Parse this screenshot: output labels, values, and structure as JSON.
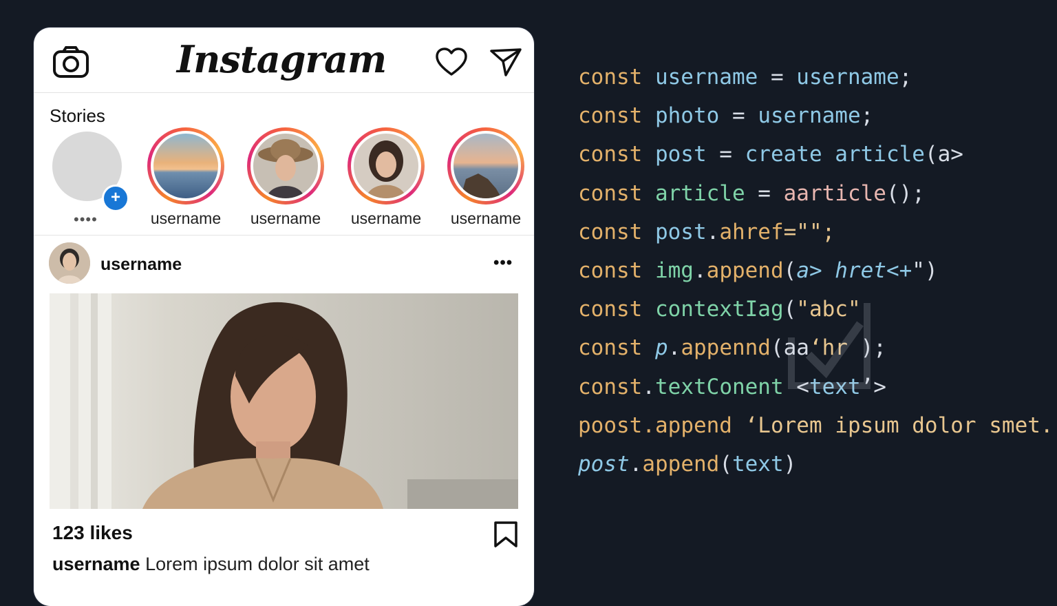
{
  "app": {
    "logo_text": "Instagram",
    "icons": [
      "camera-icon",
      "heart-icon",
      "send-icon"
    ]
  },
  "stories": {
    "title": "Stories",
    "own_dots": "••••",
    "items": [
      {
        "label": "username",
        "photo": "sunset-sea"
      },
      {
        "label": "username",
        "photo": "woman-hat"
      },
      {
        "label": "username",
        "photo": "woman-portrait"
      },
      {
        "label": "username",
        "photo": "coast-rocks"
      }
    ]
  },
  "post": {
    "username": "username",
    "more_label": "•••",
    "likes": "123 likes",
    "caption_user": "username",
    "caption_text": "Lorem ipsum dolor sit amet"
  },
  "code": {
    "lines": [
      [
        {
          "t": "const ",
          "c": "kw"
        },
        {
          "t": "username",
          "c": "id"
        },
        {
          "t": " = ",
          "c": ""
        },
        {
          "t": "username",
          "c": "id"
        },
        {
          "t": ";",
          "c": ""
        }
      ],
      [
        {
          "t": "const ",
          "c": "kw"
        },
        {
          "t": "photo",
          "c": "id"
        },
        {
          "t": " = ",
          "c": ""
        },
        {
          "t": "username",
          "c": "id"
        },
        {
          "t": ";",
          "c": ""
        }
      ],
      [
        {
          "t": "const ",
          "c": "kw"
        },
        {
          "t": "post",
          "c": "id"
        },
        {
          "t": " = ",
          "c": ""
        },
        {
          "t": "create article",
          "c": "id"
        },
        {
          "t": "(a>",
          "c": ""
        }
      ],
      [
        {
          "t": "const ",
          "c": "kw"
        },
        {
          "t": "article",
          "c": "gr"
        },
        {
          "t": " = ",
          "c": ""
        },
        {
          "t": "aarticle",
          "c": "pk"
        },
        {
          "t": "();",
          "c": ""
        }
      ],
      [
        {
          "t": "const ",
          "c": "kw"
        },
        {
          "t": "post",
          "c": "id"
        },
        {
          "t": ".",
          "c": ""
        },
        {
          "t": "ahref",
          "c": "kw"
        },
        {
          "t": "=\"\";",
          "c": "st"
        }
      ],
      [
        {
          "t": "const ",
          "c": "kw"
        },
        {
          "t": "img",
          "c": "gr"
        },
        {
          "t": ".",
          "c": ""
        },
        {
          "t": "append",
          "c": "kw"
        },
        {
          "t": "(",
          "c": ""
        },
        {
          "t": "a> hret<+",
          "c": "it"
        },
        {
          "t": "\")",
          "c": ""
        }
      ],
      [
        {
          "t": "const ",
          "c": "kw"
        },
        {
          "t": "contextIag",
          "c": "gr"
        },
        {
          "t": "(",
          "c": ""
        },
        {
          "t": "\"abc\"",
          "c": "st"
        }
      ],
      [
        {
          "t": "const ",
          "c": "kw"
        },
        {
          "t": "p",
          "c": "it"
        },
        {
          "t": ".",
          "c": ""
        },
        {
          "t": "appennd",
          "c": "kw"
        },
        {
          "t": "(aa",
          "c": ""
        },
        {
          "t": "‘hr",
          "c": "st"
        },
        {
          "t": " );",
          "c": ""
        }
      ],
      [
        {
          "t": "const",
          "c": "kw"
        },
        {
          "t": ".",
          "c": ""
        },
        {
          "t": "textConent",
          "c": "gr"
        },
        {
          "t": " <",
          "c": ""
        },
        {
          "t": "text",
          "c": "id"
        },
        {
          "t": "’>",
          "c": ""
        }
      ],
      [
        {
          "t": "poost",
          "c": "kw"
        },
        {
          "t": ".append ",
          "c": "kw"
        },
        {
          "t": "‘Lorem ipsum dolor smet.’",
          "c": "st"
        }
      ],
      [
        {
          "t": "post",
          "c": "it"
        },
        {
          "t": ".",
          "c": ""
        },
        {
          "t": "append",
          "c": "kw"
        },
        {
          "t": "(",
          "c": ""
        },
        {
          "t": "text",
          "c": "id"
        },
        {
          "t": ")",
          "c": ""
        }
      ]
    ]
  },
  "colors": {
    "background": "#141a24",
    "accent_blue": "#1877d6",
    "story_ring": [
      "#f58529",
      "#dd2a7b",
      "#fcaf45"
    ]
  }
}
